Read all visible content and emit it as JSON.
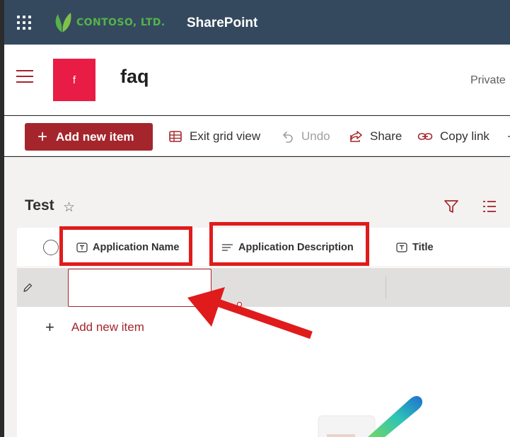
{
  "suite_bar": {
    "company": "CONTOSO, LTD.",
    "app_name": "SharePoint",
    "background_color": "#34495e",
    "icons": [
      "waffle-icon",
      "leaf-logo-icon"
    ]
  },
  "site_header": {
    "logo_letter": "f",
    "logo_color": "#e81c45",
    "title": "faq",
    "privacy": "Private"
  },
  "command_bar": {
    "add_new_item": "Add new item",
    "exit_grid_view": "Exit grid view",
    "undo": "Undo",
    "share": "Share",
    "copy_link": "Copy link",
    "accent_color": "#a4262c"
  },
  "list": {
    "title": "Test",
    "favorite_icon": "star-icon",
    "columns": [
      {
        "label": "Application Name",
        "icon": "text-column-icon"
      },
      {
        "label": "Application Description",
        "icon": "multiline-text-column-icon"
      },
      {
        "label": "Title",
        "icon": "text-column-icon"
      }
    ],
    "add_new_item": "Add new item"
  },
  "annotation": {
    "color": "#e01b1b",
    "description_hidden": ""
  }
}
